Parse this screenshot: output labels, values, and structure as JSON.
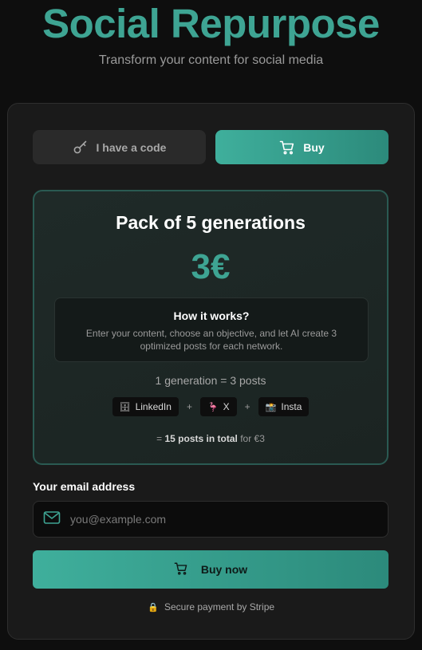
{
  "header": {
    "title": "Social Repurpose",
    "subtitle": "Transform your content for social media"
  },
  "tabs": {
    "code": {
      "label": "I have a code",
      "icon": "key-icon"
    },
    "buy": {
      "label": "Buy",
      "icon": "cart-icon"
    }
  },
  "pack": {
    "title": "Pack of 5 generations",
    "price": "3€",
    "how_title": "How it works?",
    "how_desc": "Enter your content, choose an objective, and let AI create 3 optimized posts for each network.",
    "generation_line": "1 generation = 3 posts",
    "networks": [
      {
        "icon": "🗄",
        "label": "LinkedIn"
      },
      {
        "icon": "🦩",
        "label": "X"
      },
      {
        "icon": "📸",
        "label": "Insta"
      }
    ],
    "plus": "+",
    "total_prefix": "=",
    "total_bold": "15 posts in total",
    "total_suffix": "for €3"
  },
  "email": {
    "label": "Your email address",
    "placeholder": "you@example.com",
    "value": ""
  },
  "buy_now": {
    "label": "Buy now",
    "icon": "cart-icon"
  },
  "secure": {
    "icon": "🔒",
    "text": "Secure payment by Stripe"
  },
  "colors": {
    "accent": "#3ea493",
    "background": "#0e0e0e",
    "card": "#1a1a1a"
  }
}
